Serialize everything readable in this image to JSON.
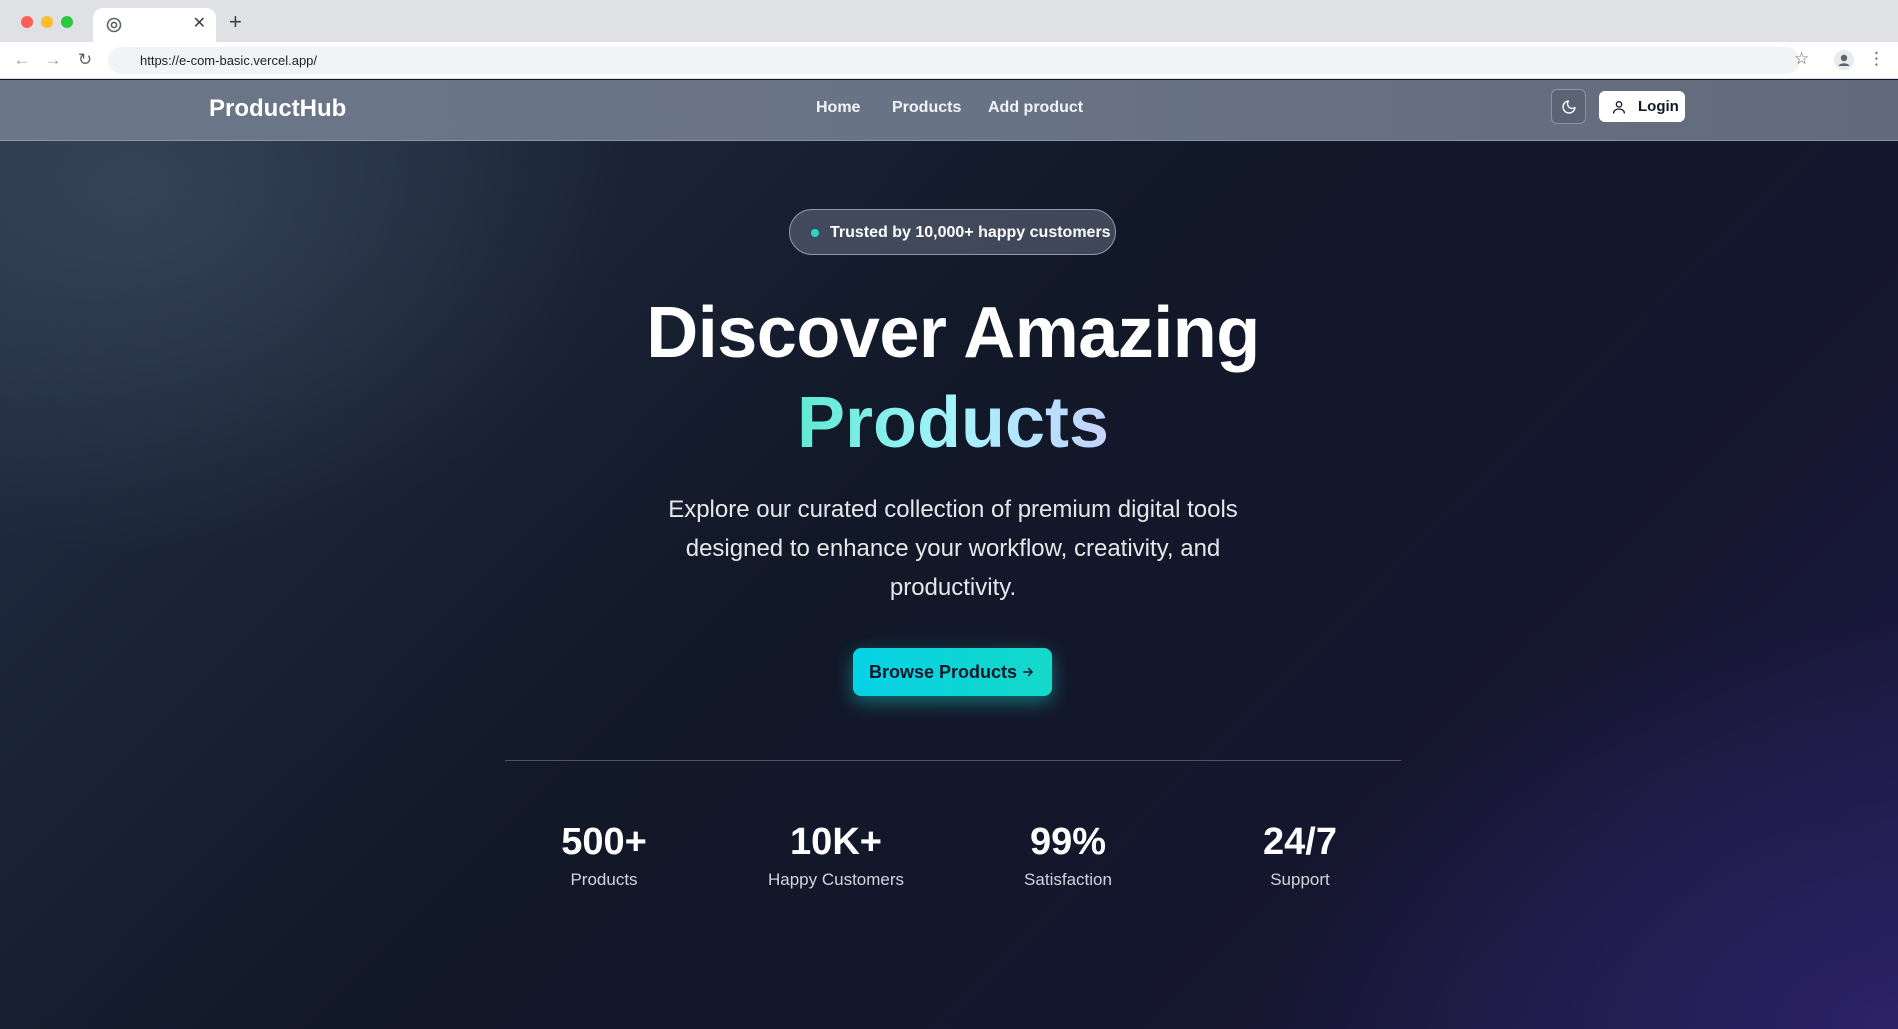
{
  "browser": {
    "url": "https://e-com-basic.vercel.app/",
    "icons": [
      "chrome-favicon",
      "close-icon",
      "new-tab-icon",
      "back-icon",
      "forward-icon",
      "reload-icon",
      "star-icon",
      "profile-icon",
      "kebab-menu-icon"
    ]
  },
  "nav": {
    "brand": "ProductHub",
    "links": [
      "Home",
      "Products",
      "Add product"
    ],
    "login_label": "Login",
    "icons": [
      "moon-icon",
      "user-icon"
    ]
  },
  "hero": {
    "badge": "Trusted by 10,000+ happy customers",
    "title_line1": "Discover Amazing",
    "title_line2": "Products",
    "subtitle": "Explore our curated collection of premium digital tools designed to enhance your workflow, creativity, and productivity.",
    "cta_label": "Browse Products",
    "cta_icon": "arrow-right-icon"
  },
  "stats": [
    {
      "value": "500+",
      "label": "Products"
    },
    {
      "value": "10K+",
      "label": "Happy Customers"
    },
    {
      "value": "99%",
      "label": "Satisfaction"
    },
    {
      "value": "24/7",
      "label": "Support"
    }
  ],
  "colors": {
    "accent": "#14d8c8",
    "badge_dot": "#2dd4bf",
    "gradient_text_start": "#5eead4",
    "gradient_text_end": "#c7d2fe",
    "navbar": "#6b7688"
  }
}
